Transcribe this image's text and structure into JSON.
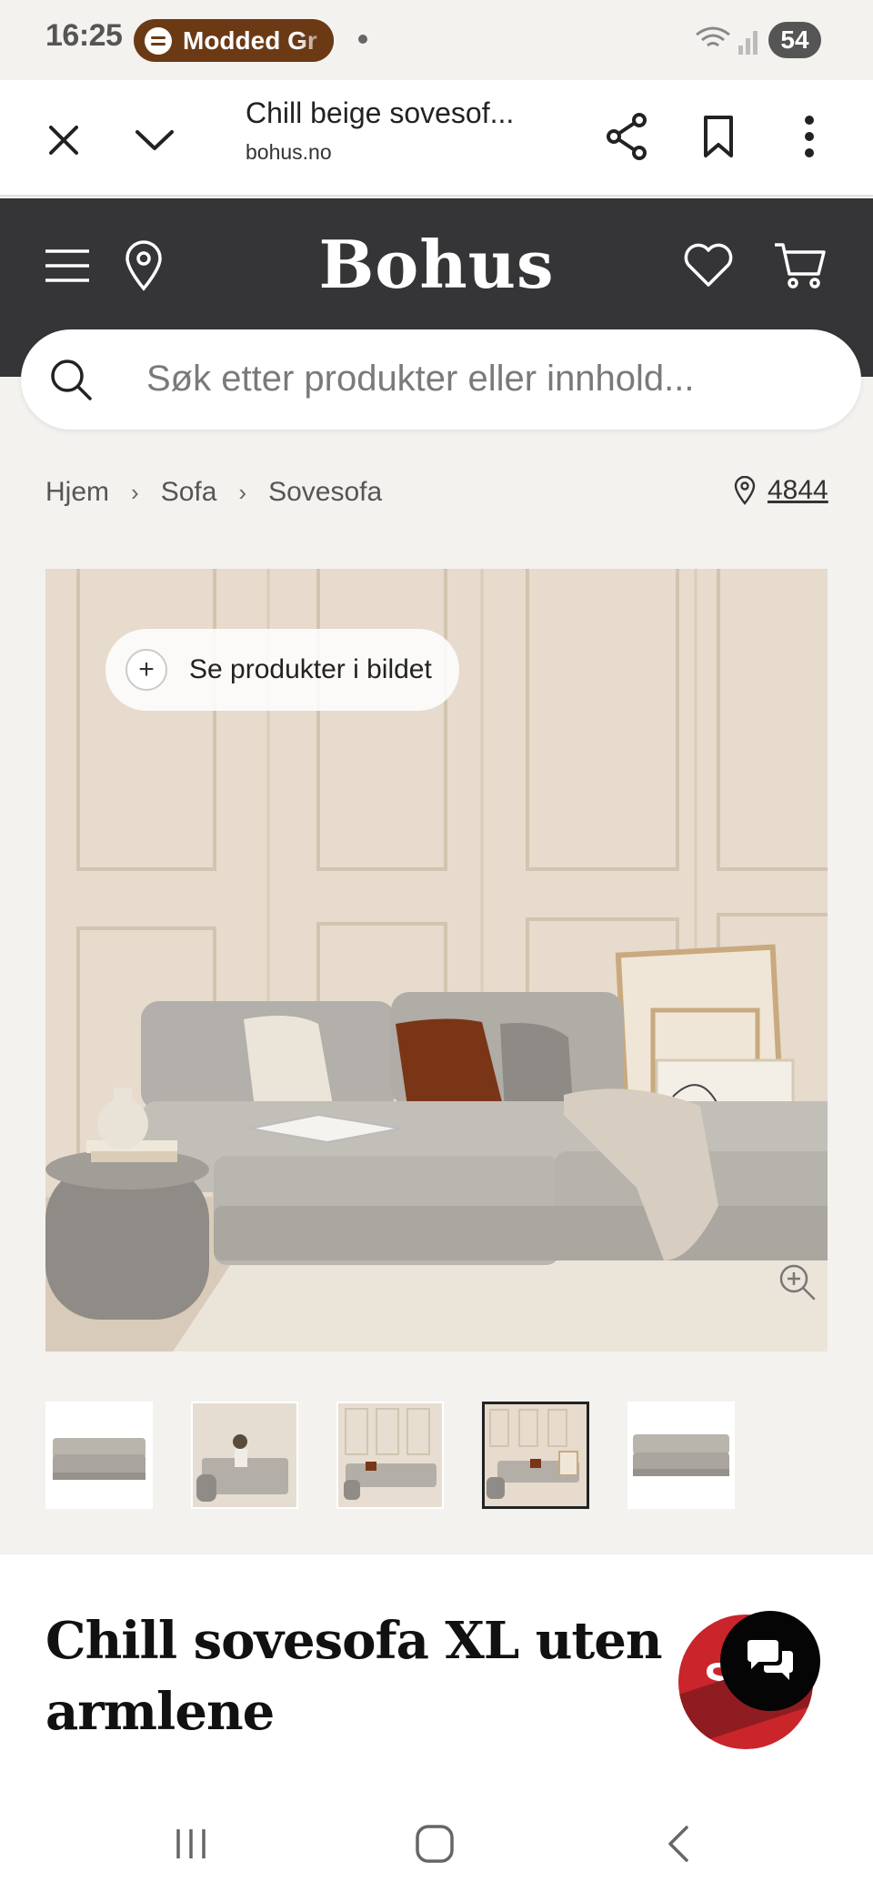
{
  "status_bar": {
    "time": "16:25",
    "media_pill": "Modded Gr",
    "battery": "54"
  },
  "browser": {
    "page_title": "Chill beige sovesof...",
    "url": "bohus.no"
  },
  "site": {
    "logo": "Bohus",
    "search_placeholder": "Søk etter produkter eller innhold..."
  },
  "breadcrumb": {
    "items": [
      "Hjem",
      "Sofa",
      "Sovesofa"
    ],
    "store_number": "4844"
  },
  "gallery": {
    "see_products_label": "Se produkter i bildet",
    "thumbnail_count": 5,
    "active_thumbnail": 4
  },
  "product": {
    "title": "Chill sovesofa XL uten armlene",
    "badge_letter": "S"
  },
  "colors": {
    "header_bg": "#353437",
    "page_bg": "#f4f2ef",
    "sale_red": "#c9252b",
    "pill_brown": "#6b3a15"
  },
  "icons": {
    "toolbar": [
      "close-icon",
      "chevron-down-icon",
      "share-icon",
      "bookmark-icon",
      "more-vertical-icon"
    ],
    "header": [
      "menu-icon",
      "location-pin-icon",
      "heart-icon",
      "cart-icon"
    ],
    "nav": [
      "recent-apps-icon",
      "home-icon",
      "back-icon"
    ]
  }
}
